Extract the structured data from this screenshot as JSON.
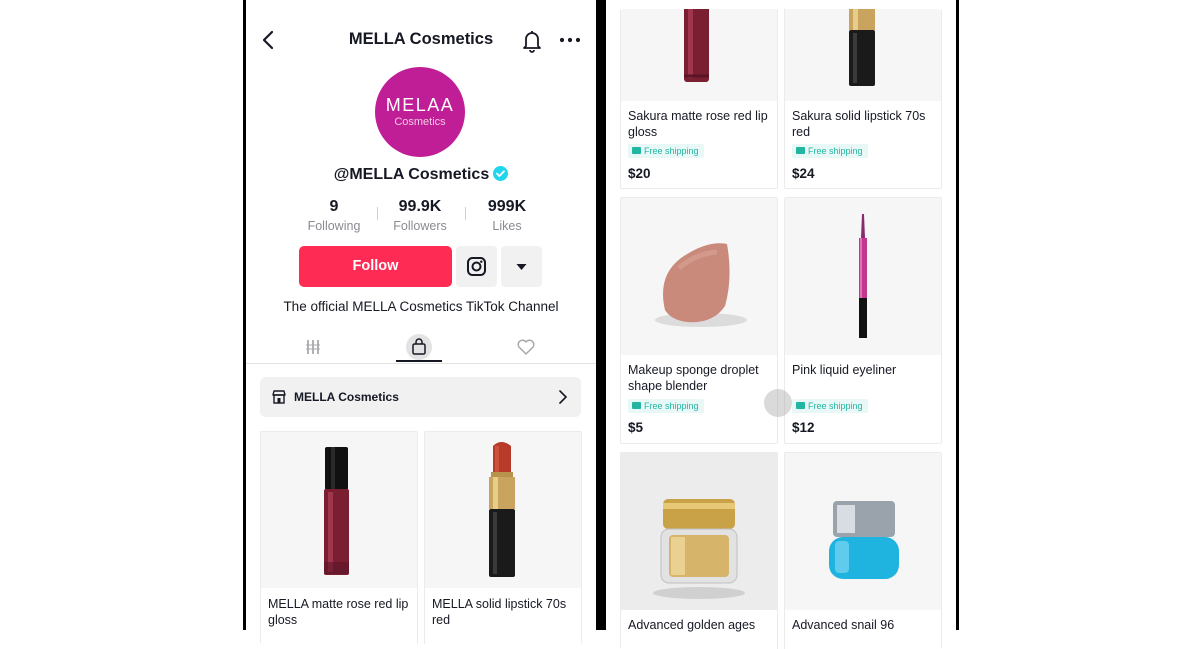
{
  "profile": {
    "header_title": "MELLA Cosmetics",
    "logo_line1": "MELAA",
    "logo_line2": "Cosmetics",
    "handle": "@MELLA Cosmetics",
    "stats": [
      {
        "value": "9",
        "label": "Following"
      },
      {
        "value": "99.9K",
        "label": "Followers"
      },
      {
        "value": "999K",
        "label": "Likes"
      }
    ],
    "follow_label": "Follow",
    "bio": "The official MELLA Cosmetics TikTok Channel",
    "shop_bar_label": "MELLA Cosmetics"
  },
  "left_products": [
    {
      "name": "MELLA matte rose red lip gloss"
    },
    {
      "name": "MELLA solid lipstick 70s red"
    }
  ],
  "right_products": [
    {
      "name": "Sakura matte rose red lip gloss",
      "shipping": "Free shipping",
      "price": "$20"
    },
    {
      "name": "Sakura solid lipstick 70s red",
      "shipping": "Free shipping",
      "price": "$24"
    },
    {
      "name": "Makeup sponge droplet shape blender",
      "shipping": "Free shipping",
      "price": "$5"
    },
    {
      "name": "Pink liquid eyeliner",
      "shipping": "Free shipping",
      "price": "$12"
    },
    {
      "name": "Advanced golden ages"
    },
    {
      "name": "Advanced snail 96"
    }
  ],
  "colors": {
    "accent": "#fe2c55",
    "logo": "#c01e96",
    "shipping": "#22b5a2"
  }
}
